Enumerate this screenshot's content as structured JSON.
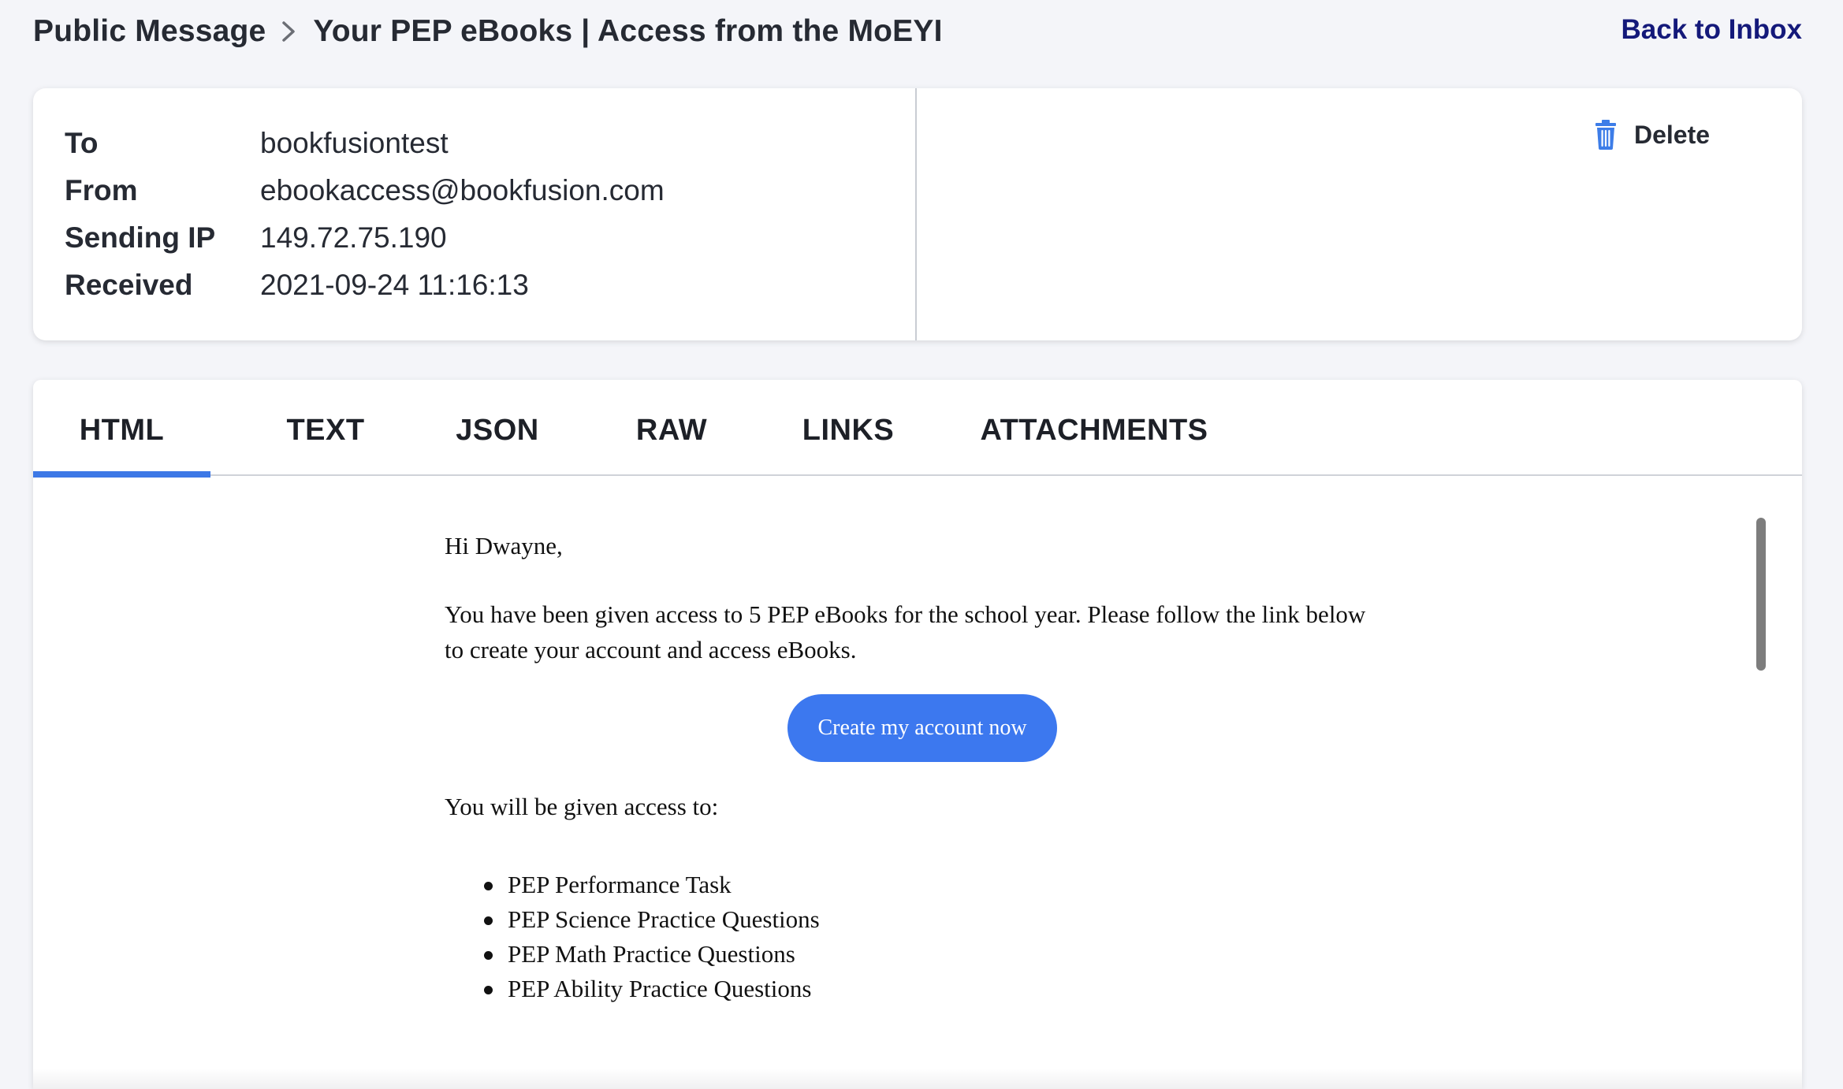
{
  "header": {
    "breadcrumb_root": "Public Message",
    "breadcrumb_subject": "Your PEP eBooks | Access from the MoEYI",
    "back_link": "Back to Inbox"
  },
  "meta": {
    "to_label": "To",
    "to_value": "bookfusiontest",
    "from_label": "From",
    "from_value": "ebookaccess@bookfusion.com",
    "ip_label": "Sending IP",
    "ip_value": "149.72.75.190",
    "received_label": "Received",
    "received_value": "2021-09-24 11:16:13",
    "delete_label": "Delete"
  },
  "tabs": [
    {
      "label": "HTML",
      "active": true
    },
    {
      "label": "TEXT",
      "active": false
    },
    {
      "label": "JSON",
      "active": false
    },
    {
      "label": "RAW",
      "active": false
    },
    {
      "label": "LINKS",
      "active": false
    },
    {
      "label": "ATTACHMENTS",
      "active": false
    }
  ],
  "message": {
    "greeting": "Hi Dwayne,",
    "intro": "You have been given access to 5 PEP eBooks for the school year. Please follow the link below to create your account and access eBooks.",
    "cta": "Create my account now",
    "access_heading": "You will be given access to:",
    "access_items": [
      "PEP Performance Task",
      "PEP Science Practice Questions",
      "PEP Math Practice Questions",
      "PEP Ability Practice Questions"
    ]
  },
  "colors": {
    "accent": "#3c78e6",
    "back_link": "#14197a",
    "cta_button": "#3c78ef",
    "page_bg": "#f4f5f9"
  },
  "icons": {
    "breadcrumb_separator": "chevron-right-icon",
    "delete": "trash-icon"
  }
}
